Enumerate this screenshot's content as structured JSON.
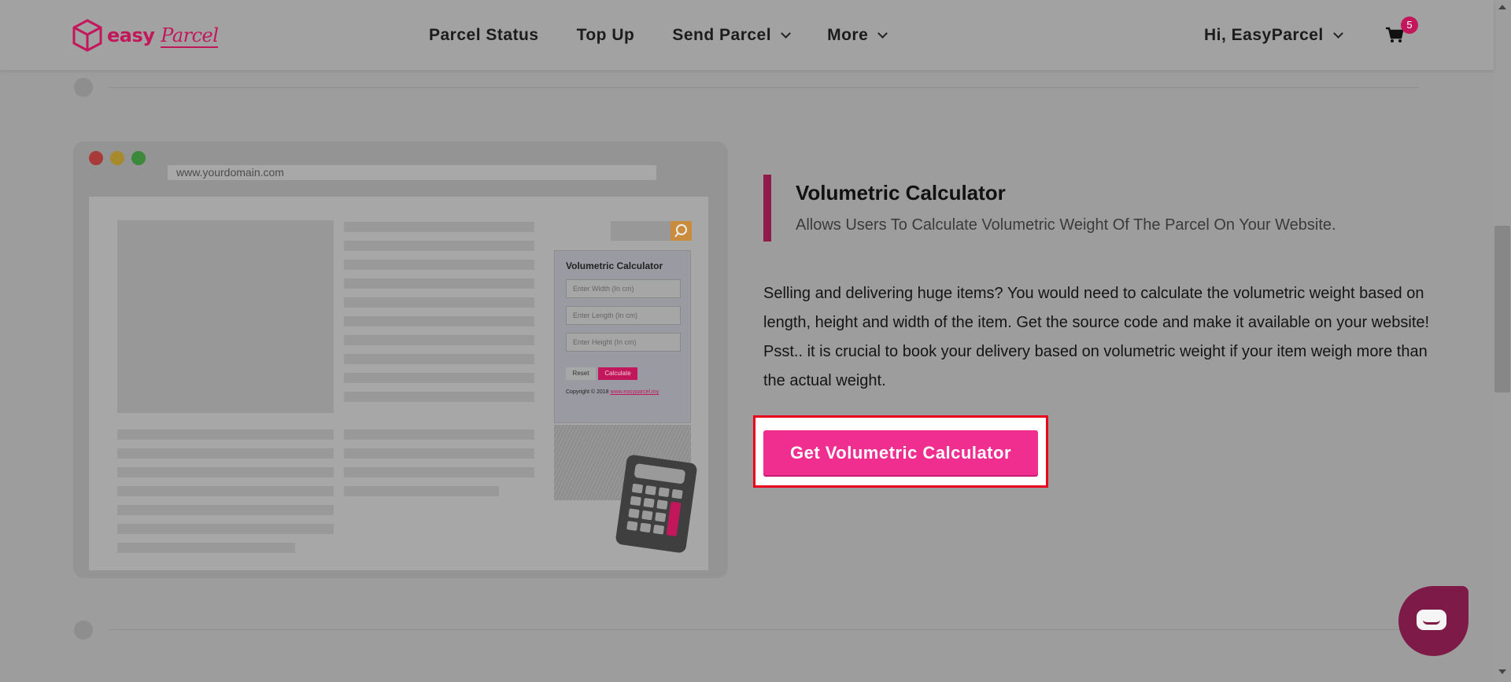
{
  "header": {
    "logo_text": "easy",
    "logo_script": "Parcel",
    "nav": [
      {
        "label": "Parcel Status"
      },
      {
        "label": "Top Up"
      },
      {
        "label": "Send Parcel"
      },
      {
        "label": "More"
      }
    ],
    "user_label": "Hi, EasyParcel",
    "cart_count": "5"
  },
  "illustration": {
    "url": "www.yourdomain.com",
    "widget_title": "Volumetric Calculator",
    "fields": [
      "Enter Width (In cm)",
      "Enter Length (In cm)",
      "Enter Height (In cm)"
    ],
    "reset_label": "Reset",
    "calculate_label": "Calculate",
    "copyright_prefix": "Copyright © 2018",
    "copyright_link": "www.easyparcel.my"
  },
  "section": {
    "title": "Volumetric Calculator",
    "subtitle": "Allows Users To Calculate Volumetric Weight Of The Parcel On Your Website.",
    "body": "Selling and delivering huge items? You would need to calculate the volumetric weight based on length, height and width of the item. Get the source code and make it available on your website! Psst.. it is crucial to book your delivery based on volumetric weight if your item weigh more than the actual weight.",
    "cta_label": "Get Volumetric Calculator"
  },
  "colors": {
    "brand": "#c2185b",
    "cta": "#ef2e8f",
    "highlight": "#e8001c",
    "chat": "#7e1a48"
  }
}
